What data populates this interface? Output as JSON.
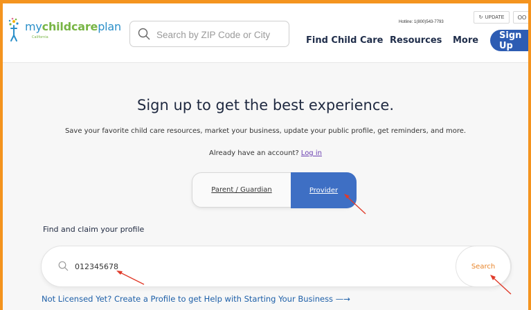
{
  "header": {
    "logo": {
      "brand_prefix": "my",
      "brand_main": "childcare",
      "brand_suffix": "plan",
      "sub": "California"
    },
    "search": {
      "placeholder": "Search by ZIP Code or City",
      "icon": "search-icon"
    },
    "hotline": "Hotline: 1(800)543-7793",
    "update_label": "UPDATE",
    "small_button_label": "OO",
    "nav": [
      {
        "label": "Find Child Care"
      },
      {
        "label": "Resources"
      },
      {
        "label": "More"
      }
    ],
    "signup_label": "Sign Up"
  },
  "main": {
    "title": "Sign up to get the best experience.",
    "subtitle": "Save your favorite child care resources, market your business, update your public profile, get reminders, and more.",
    "account_prompt": "Already have an account?",
    "login_label": "Log in",
    "toggle": {
      "parent_label": "Parent / Guardian",
      "provider_label": "Provider",
      "selected": "Provider"
    },
    "claim_label": "Find and claim your profile",
    "claim_search": {
      "value": "012345678",
      "button_label": "Search"
    },
    "not_licensed": "Not Licensed Yet? Create a Profile to get Help with Starting Your Business —→"
  },
  "colors": {
    "frame_border": "#f4941f",
    "accent_blue": "#3e6fc4",
    "signup_blue": "#2d5cb3",
    "search_orange": "#e8852a",
    "annotation_red": "#e03b2a"
  }
}
